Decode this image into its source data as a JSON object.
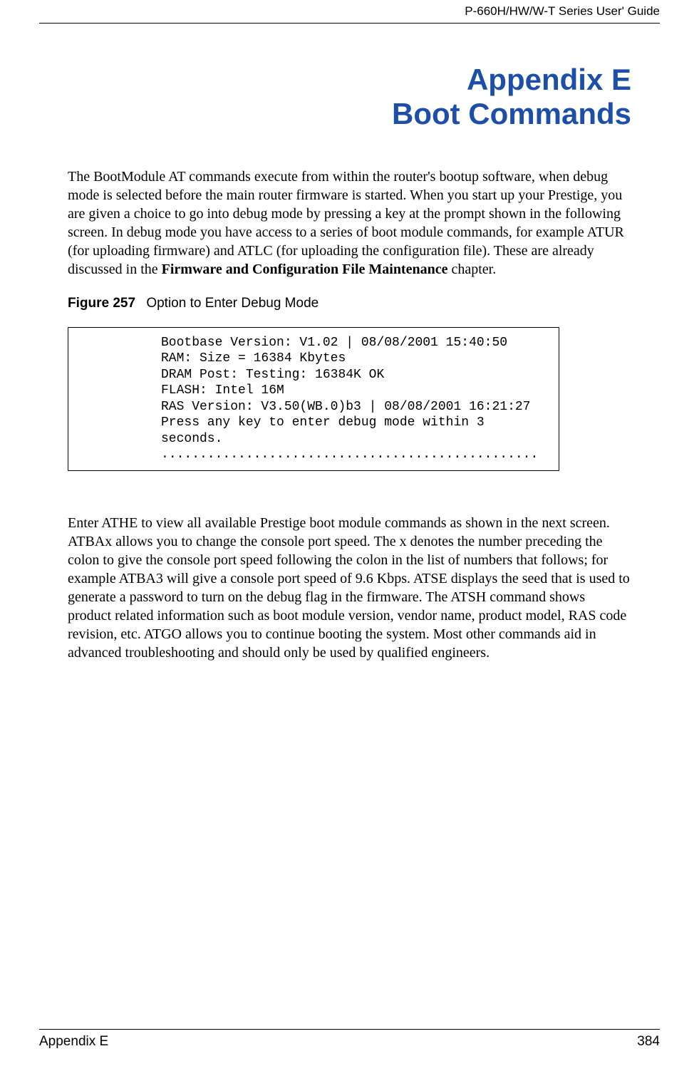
{
  "header": {
    "guide_title": "P-660H/HW/W-T Series User' Guide"
  },
  "title": {
    "line1": "Appendix E",
    "line2": "Boot Commands"
  },
  "paragraphs": {
    "intro_part1": "The BootModule AT commands execute from within the router's bootup software, when debug mode is selected before the main router firmware is started. When you start up your Prestige, you are given a choice to go into debug mode by pressing a key at the prompt shown in the following screen. In debug mode you have access to a series of boot module commands, for example ATUR (for uploading firmware) and ATLC (for uploading the configuration file). These are already discussed in the ",
    "intro_bold": "Firmware and Configuration File Maintenance",
    "intro_part2": " chapter.",
    "second": "Enter ATHE to view all available Prestige boot module commands as shown in the next screen. ATBAx allows you to change the console port speed. The x denotes the number preceding the colon to give the console port speed following the colon in the list of numbers that follows; for example ATBA3 will give a console port speed of 9.6 Kbps. ATSE displays the seed that is used to generate a password to turn on the debug flag in the firmware. The ATSH command shows product related information such as boot module version, vendor name, product model, RAS code revision, etc. ATGO allows you to continue booting the system. Most other commands aid in advanced troubleshooting and should only be used by qualified engineers."
  },
  "figure": {
    "number": "Figure 257",
    "caption": "Option to Enter Debug Mode",
    "code": "Bootbase Version: V1.02 | 08/08/2001 15:40:50\nRAM: Size = 16384 Kbytes\nDRAM Post: Testing: 16384K OK\nFLASH: Intel 16M\nRAS Version: V3.50(WB.0)b3 | 08/08/2001 16:21:27\nPress any key to enter debug mode within 3 seconds.\n................................................."
  },
  "footer": {
    "left": "Appendix E",
    "right": "384"
  }
}
